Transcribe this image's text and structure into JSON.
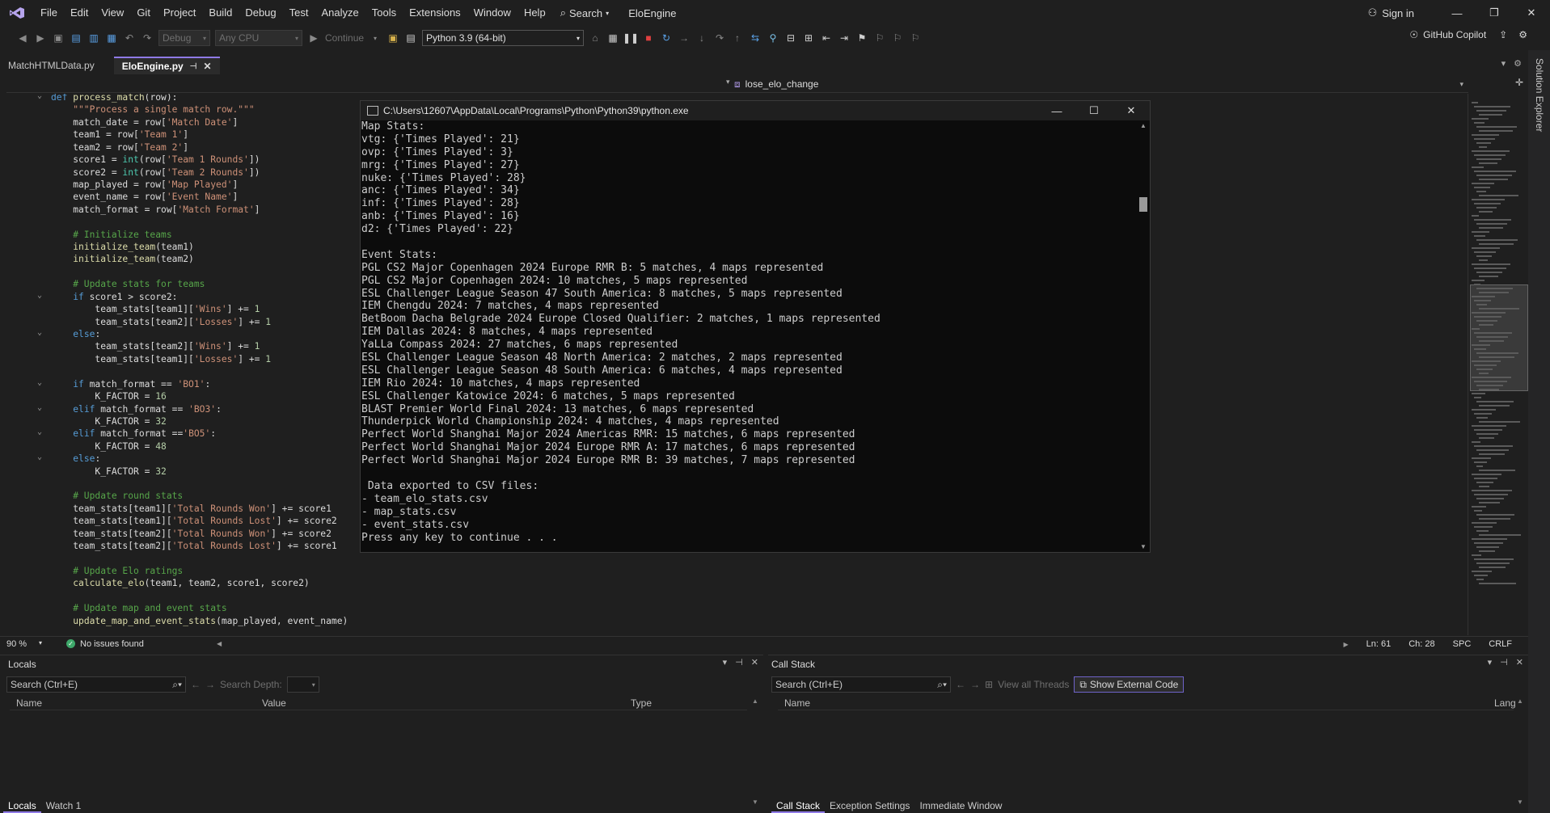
{
  "menu": {
    "items": [
      "File",
      "Edit",
      "View",
      "Git",
      "Project",
      "Build",
      "Debug",
      "Test",
      "Analyze",
      "Tools",
      "Extensions",
      "Window",
      "Help"
    ],
    "search_label": "Search",
    "app_title": "EloEngine",
    "sign_in": "Sign in"
  },
  "toolbar": {
    "config": "Debug",
    "platform": "Any CPU",
    "continue": "Continue",
    "environment": "Python 3.9 (64-bit)",
    "copilot": "GitHub Copilot"
  },
  "tabs": [
    {
      "label": "MatchHTMLData.py",
      "active": false
    },
    {
      "label": "EloEngine.py",
      "active": true
    }
  ],
  "navbar": {
    "member": "lose_elo_change"
  },
  "right_panel": {
    "label": "Solution Explorer"
  },
  "editor": {
    "lines": [
      "def process_match(row):",
      "    \"\"\"Process a single match row.\"\"\"",
      "    match_date = row['Match Date']",
      "    team1 = row['Team 1']",
      "    team2 = row['Team 2']",
      "    score1 = int(row['Team 1 Rounds'])",
      "    score2 = int(row['Team 2 Rounds'])",
      "    map_played = row['Map Played']",
      "    event_name = row['Event Name']",
      "    match_format = row['Match Format']",
      "",
      "    # Initialize teams",
      "    initialize_team(team1)",
      "    initialize_team(team2)",
      "",
      "    # Update stats for teams",
      "    if score1 > score2:",
      "        team_stats[team1]['Wins'] += 1",
      "        team_stats[team2]['Losses'] += 1",
      "    else:",
      "        team_stats[team2]['Wins'] += 1",
      "        team_stats[team1]['Losses'] += 1",
      "",
      "    if match_format == 'BO1':",
      "        K_FACTOR = 16",
      "    elif match_format == 'BO3':",
      "        K_FACTOR = 32",
      "    elif match_format =='BO5':",
      "        K_FACTOR = 48",
      "    else:",
      "        K_FACTOR = 32",
      "",
      "    # Update round stats",
      "    team_stats[team1]['Total Rounds Won'] += score1",
      "    team_stats[team1]['Total Rounds Lost'] += score2",
      "    team_stats[team2]['Total Rounds Won'] += score2",
      "    team_stats[team2]['Total Rounds Lost'] += score1",
      "",
      "    # Update Elo ratings",
      "    calculate_elo(team1, team2, score1, score2)",
      "",
      "    # Update map and event stats",
      "    update_map_and_event_stats(map_played, event_name)"
    ],
    "zoom": "90 %",
    "issues": "No issues found",
    "line": "Ln: 61",
    "col": "Ch: 28",
    "whitespace": "SPC",
    "line_ending": "CRLF"
  },
  "console": {
    "title": "C:\\Users\\12607\\AppData\\Local\\Programs\\Python\\Python39\\python.exe",
    "lines": [
      "Map Stats:",
      "vtg: {'Times Played': 21}",
      "ovp: {'Times Played': 3}",
      "mrg: {'Times Played': 27}",
      "nuke: {'Times Played': 28}",
      "anc: {'Times Played': 34}",
      "inf: {'Times Played': 28}",
      "anb: {'Times Played': 16}",
      "d2: {'Times Played': 22}",
      "",
      "Event Stats:",
      "PGL CS2 Major Copenhagen 2024 Europe RMR B: 5 matches, 4 maps represented",
      "PGL CS2 Major Copenhagen 2024: 10 matches, 5 maps represented",
      "ESL Challenger League Season 47 South America: 8 matches, 5 maps represented",
      "IEM Chengdu 2024: 7 matches, 4 maps represented",
      "BetBoom Dacha Belgrade 2024 Europe Closed Qualifier: 2 matches, 1 maps represented",
      "IEM Dallas 2024: 8 matches, 4 maps represented",
      "YaLLa Compass 2024: 27 matches, 6 maps represented",
      "ESL Challenger League Season 48 North America: 2 matches, 2 maps represented",
      "ESL Challenger League Season 48 South America: 6 matches, 4 maps represented",
      "IEM Rio 2024: 10 matches, 4 maps represented",
      "ESL Challenger Katowice 2024: 6 matches, 5 maps represented",
      "BLAST Premier World Final 2024: 13 matches, 6 maps represented",
      "Thunderpick World Championship 2024: 4 matches, 4 maps represented",
      "Perfect World Shanghai Major 2024 Americas RMR: 15 matches, 6 maps represented",
      "Perfect World Shanghai Major 2024 Europe RMR A: 17 matches, 6 maps represented",
      "Perfect World Shanghai Major 2024 Europe RMR B: 39 matches, 7 maps represented",
      "",
      " Data exported to CSV files:",
      "- team_elo_stats.csv",
      "- map_stats.csv",
      "- event_stats.csv",
      "Press any key to continue . . ."
    ]
  },
  "locals": {
    "title": "Locals",
    "search_placeholder": "Search (Ctrl+E)",
    "search_depth": "Search Depth:",
    "columns": [
      "Name",
      "Value",
      "Type"
    ],
    "tabs": [
      "Locals",
      "Watch 1"
    ]
  },
  "callstack": {
    "title": "Call Stack",
    "search_placeholder": "Search (Ctrl+E)",
    "view_all_threads": "View all Threads",
    "show_external": "Show External Code",
    "columns": [
      "Name",
      "Lang"
    ],
    "tabs": [
      "Call Stack",
      "Exception Settings",
      "Immediate Window"
    ]
  }
}
